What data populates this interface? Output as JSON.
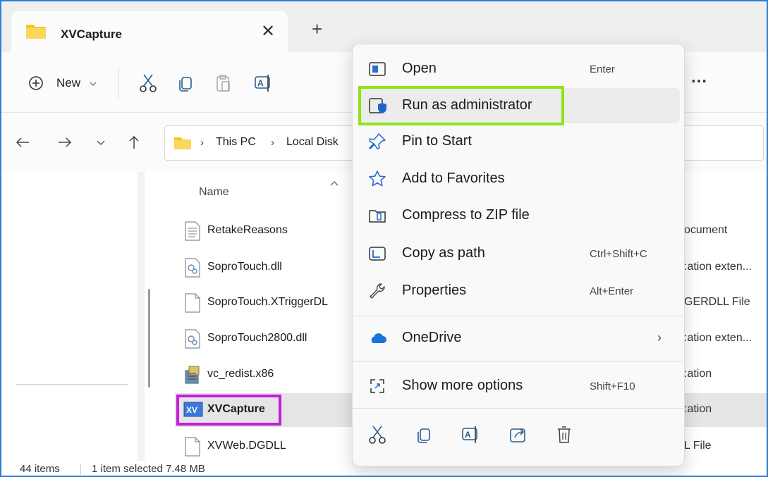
{
  "window": {
    "tab_title": "XVCapture",
    "tab_close": "✕",
    "new_tab": "+"
  },
  "toolbar": {
    "new_label": "New",
    "more": "..."
  },
  "address": {
    "segments": [
      "This PC",
      "Local Disk"
    ],
    "sep": "›"
  },
  "columns": {
    "name": "Name"
  },
  "files": [
    {
      "name": "RetakeReasons",
      "type": "ocument",
      "icon": "text-document-icon"
    },
    {
      "name": "SoproTouch.dll",
      "type": ":ation exten...",
      "icon": "dll-file-icon"
    },
    {
      "name": "SoproTouch.XTriggerDL",
      "type": "GERDLL File",
      "icon": "blank-file-icon"
    },
    {
      "name": "SoproTouch2800.dll",
      "type": ":ation exten...",
      "icon": "dll-file-icon"
    },
    {
      "name": "vc_redist.x86",
      "type": ":ation",
      "icon": "installer-icon"
    },
    {
      "name": "XVCapture",
      "type": ":ation",
      "icon": "xv-app-icon",
      "selected": true
    },
    {
      "name": "XVWeb.DGDLL",
      "type": "L File",
      "icon": "blank-file-icon"
    }
  ],
  "status": {
    "items": "44 items",
    "selected": "1 item selected 7.48 MB"
  },
  "context_menu": {
    "items": [
      {
        "label": "Open",
        "shortcut": "Enter",
        "icon": "open-icon"
      },
      {
        "label": "Run as administrator",
        "shortcut": "",
        "icon": "shield-icon"
      },
      {
        "label": "Pin to Start",
        "shortcut": "",
        "icon": "pin-icon"
      },
      {
        "label": "Add to Favorites",
        "shortcut": "",
        "icon": "star-icon"
      },
      {
        "label": "Compress to ZIP file",
        "shortcut": "",
        "icon": "zip-icon"
      },
      {
        "label": "Copy as path",
        "shortcut": "Ctrl+Shift+C",
        "icon": "copy-path-icon"
      },
      {
        "label": "Properties",
        "shortcut": "Alt+Enter",
        "icon": "wrench-icon"
      },
      {
        "label": "OneDrive",
        "shortcut": "›",
        "icon": "cloud-icon"
      },
      {
        "label": "Show more options",
        "shortcut": "Shift+F10",
        "icon": "more-options-icon"
      }
    ]
  },
  "colors": {
    "highlight_green": "#8fe31a",
    "highlight_magenta": "#c21fd8",
    "accent_blue": "#1a73d9",
    "folder_yellow": "#f4c430"
  }
}
